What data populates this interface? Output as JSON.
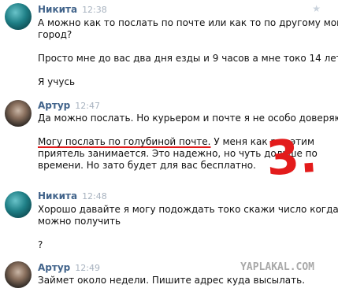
{
  "messages": [
    {
      "author": "Никита",
      "time": "12:38",
      "lines": [
        "А можно как то послать по почте или как то по другому мой в",
        "город?",
        "",
        "Просто мне до вас два дня езды и 9 часов а мне токо 14 лет",
        "",
        "Я учусь"
      ]
    },
    {
      "author": "Артур",
      "time": "12:47",
      "line1": "Да можно послать. Но курьером и почте я не особо доверяю.",
      "highlight": "Могу послать по голубиной почте.",
      "rest1": " У меня как раз этим",
      "rest2": "приятель занимается. Это надежно, но чуть дольше по",
      "rest3": "времени. Но зато будет для вас бесплатно."
    },
    {
      "author": "Никита",
      "time": "12:48",
      "lines": [
        "Хорошо давайте я могу подождать токо скажи число когда",
        "можно получить",
        "",
        "?"
      ]
    },
    {
      "author": "Артур",
      "time": "12:49",
      "lines": [
        "Займет около недели. Пишите адрес куда высылать."
      ]
    }
  ],
  "annotation": "3.",
  "watermark": "YAPLAKAL.COM",
  "icons": {
    "star": "star-icon"
  }
}
